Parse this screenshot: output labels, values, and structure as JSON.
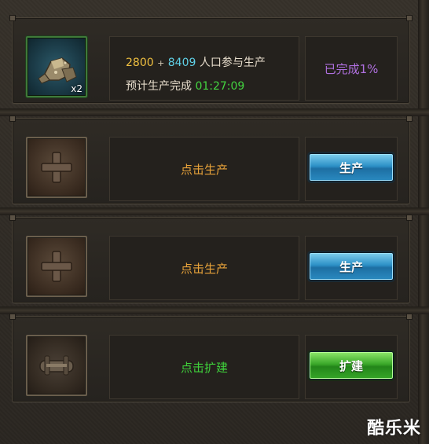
{
  "slots": [
    {
      "type": "producing",
      "icon": "ore-rocks-icon",
      "quantity": "x2",
      "population_base": "2800",
      "population_plus": "+",
      "population_bonus": "8409",
      "population_label": "人口参与生产",
      "eta_label": "预计生产完成",
      "eta_time": "01:27:09",
      "status": "已完成1%"
    },
    {
      "type": "empty",
      "icon": "plus-icon",
      "message": "点击生产",
      "button_label": "生产"
    },
    {
      "type": "empty",
      "icon": "plus-icon",
      "message": "点击生产",
      "button_label": "生产"
    },
    {
      "type": "locked",
      "icon": "handle-lock-icon",
      "message": "点击扩建",
      "button_label": "扩建"
    }
  ],
  "watermark": "酷乐米",
  "colors": {
    "yellow_number": "#f0c040",
    "cyan_number": "#5fd0e6",
    "green_time": "#43d640",
    "orange_text": "#e8a33a",
    "green_text": "#3fd03b",
    "purple_status": "#b070e0",
    "blue_button": "#2d90c6",
    "green_button": "#3aa82a"
  }
}
